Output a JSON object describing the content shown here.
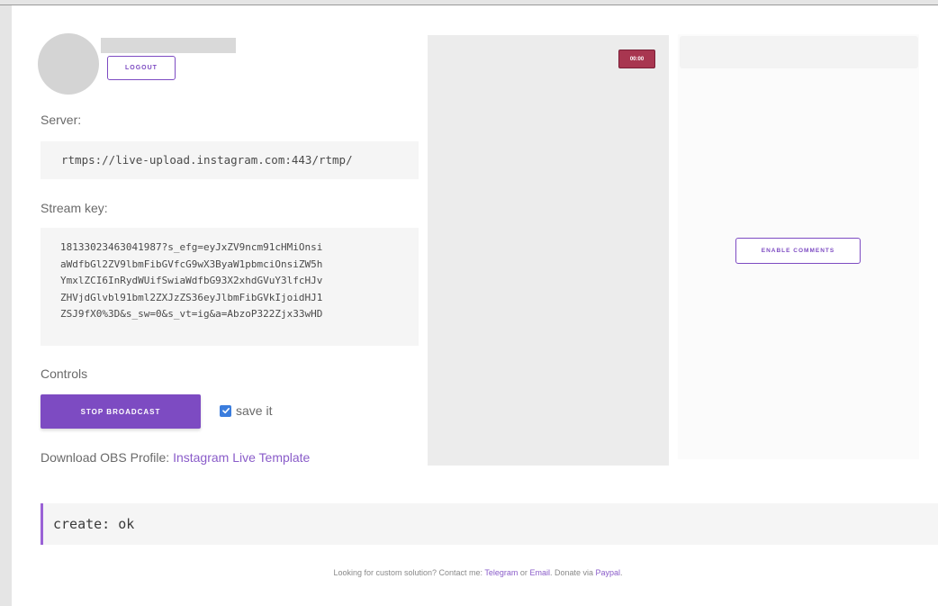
{
  "profile": {
    "logout_label": "LOGOUT"
  },
  "server": {
    "label": "Server:",
    "value": "rtmps://live-upload.instagram.com:443/rtmp/"
  },
  "stream_key": {
    "label": "Stream key:",
    "lines": [
      "18133023463041987?s_efg=eyJxZV9ncm91cHMiOnsi",
      "aWdfbGl2ZV9lbmFibGVfcG9wX3ByaW1pbmciOnsiZW5h",
      "YmxlZCI6InRydWUifSwiaWdfbG93X2xhdGVuY3lfcHJv",
      "ZHVjdGlvbl91bml2ZXJzZS36eyJlbmFibGVkIjoidHJ1",
      "ZSJ9fX0%3D&s_sw=0&s_vt=ig&a=AbzoP322Zjx33wHD"
    ]
  },
  "controls": {
    "label": "Controls",
    "stop_label": "STOP BROADCAST",
    "save_label": "save it",
    "save_checked": true
  },
  "download": {
    "prefix": "Download OBS Profile: ",
    "link": "Instagram Live Template"
  },
  "video": {
    "timer": "00:00"
  },
  "comments": {
    "enable_label": "ENABLE COMMENTS"
  },
  "status": {
    "text": "create: ok"
  },
  "footer": {
    "prefix": "Looking for custom solution? Contact me: ",
    "telegram": "Telegram",
    "or": " or ",
    "email": "Email",
    "donate": ". Donate via ",
    "paypal": "Paypal",
    "end": "."
  },
  "colors": {
    "accent": "#7d4bc2",
    "timer_badge": "#a83650",
    "checkbox": "#3b7ddd"
  }
}
